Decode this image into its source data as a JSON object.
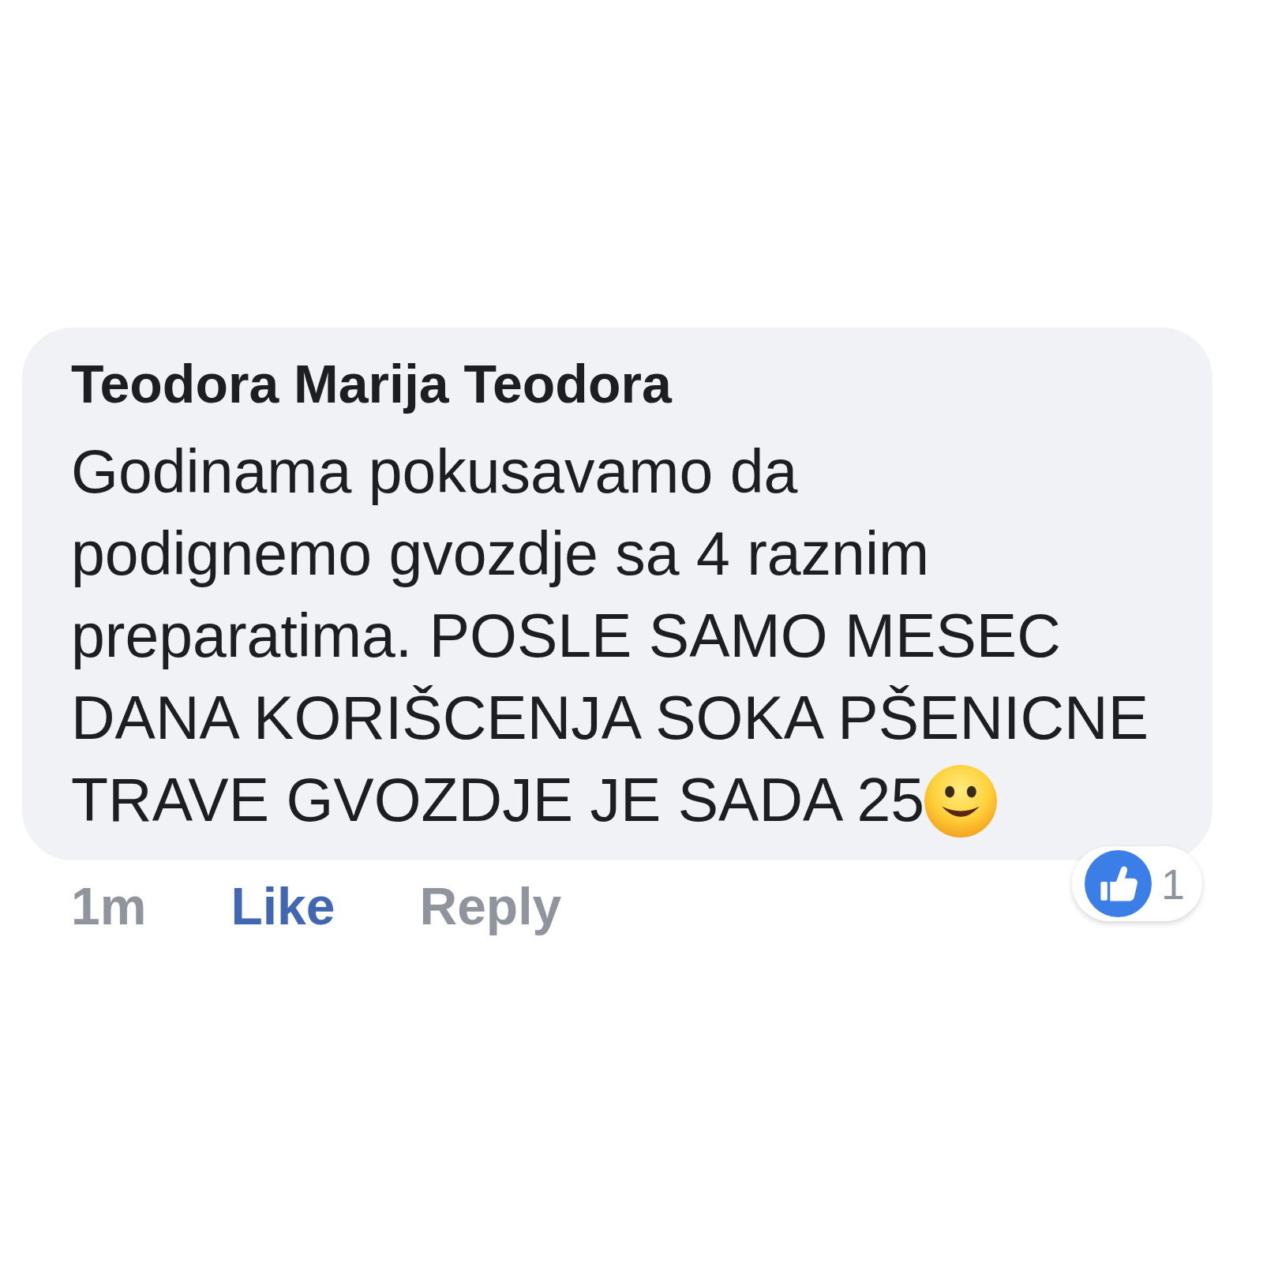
{
  "comment": {
    "author": "Teodora Marija Teodora",
    "text_lines": [
      "Godinama pokusavamo da",
      "podignemo gvozdje sa 4 raznim",
      "preparatima. POSLE SAMO MESEC",
      "DANA KORIŠCENJA SOKA PŠENICNE",
      "TRAVE GVOZDJE JE SADA 25"
    ]
  },
  "footer": {
    "time": "1m",
    "actions": [
      {
        "label": "Like",
        "active": true
      },
      {
        "label": "Reply",
        "active": false
      }
    ]
  },
  "reactions": {
    "count": "1"
  }
}
